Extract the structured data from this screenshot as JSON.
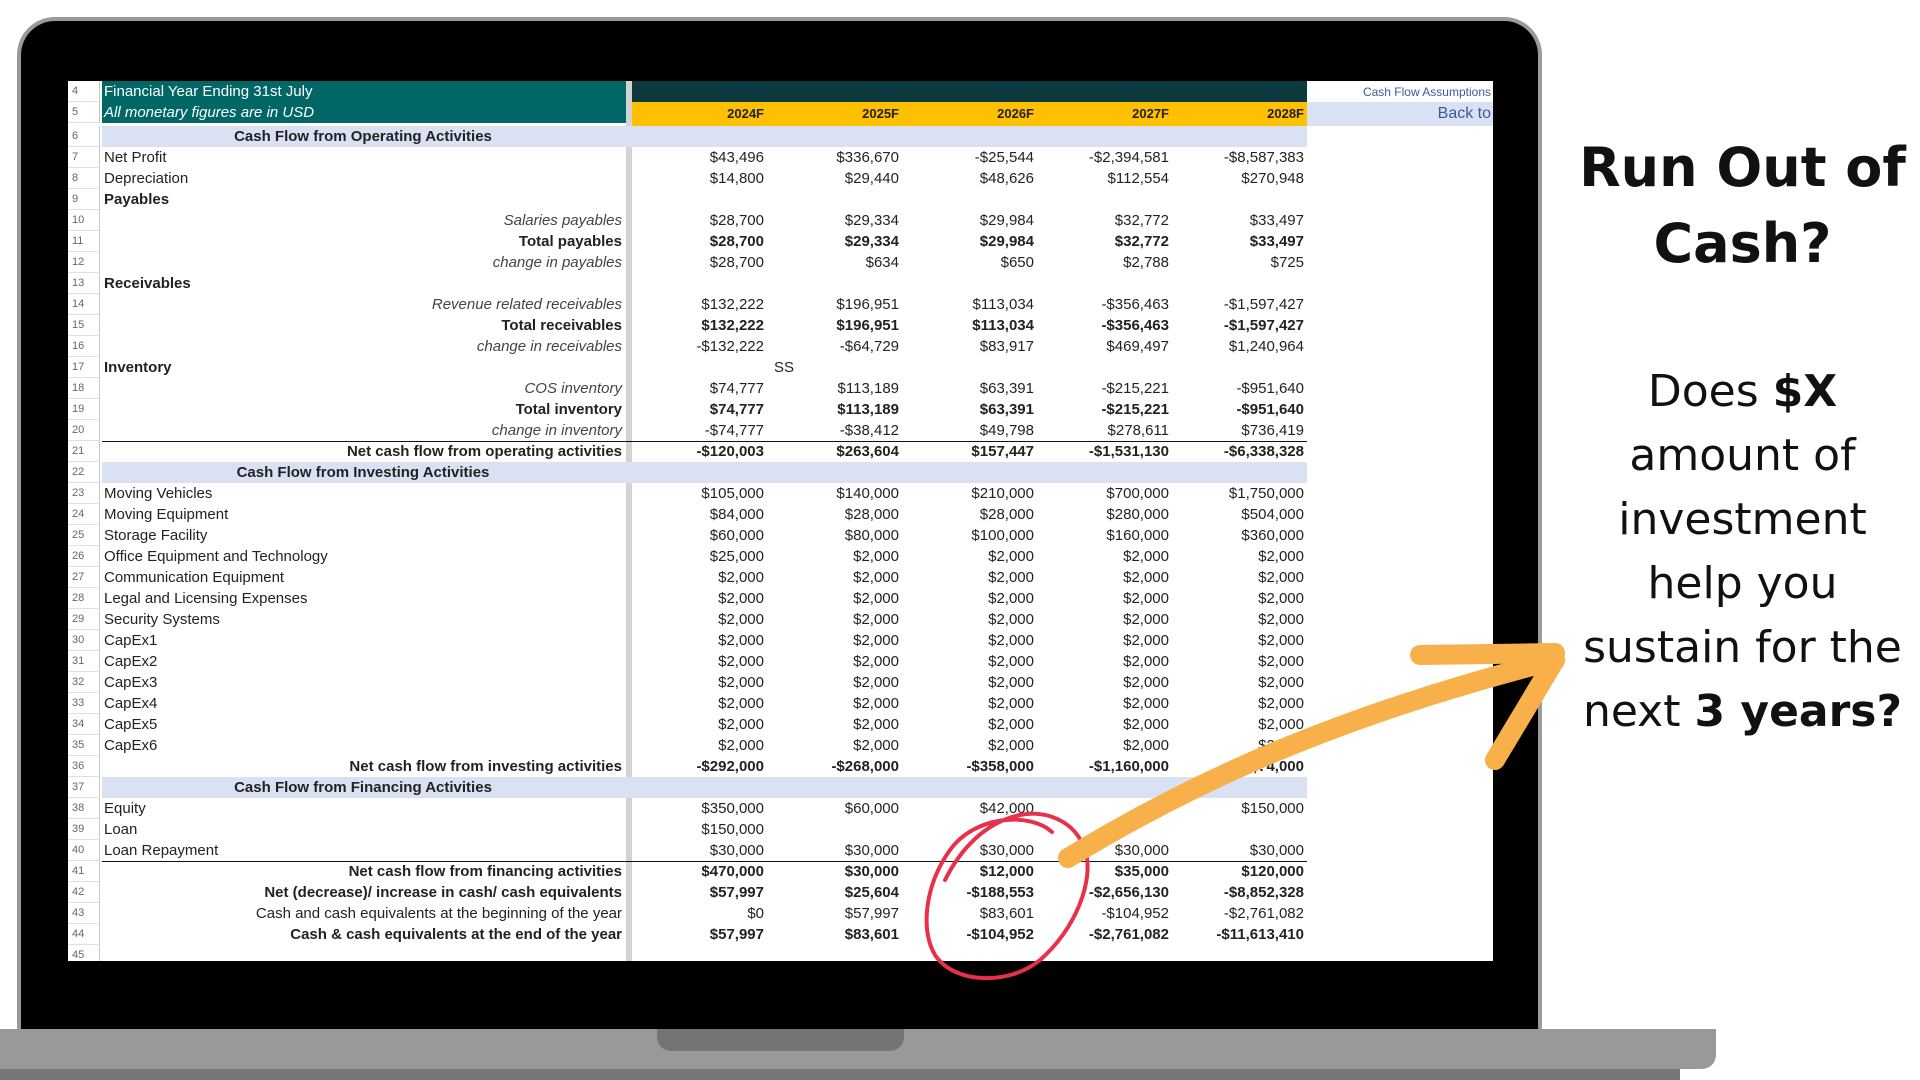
{
  "sheet": {
    "header": {
      "title": "Financial Year Ending 31st July",
      "subtitle": "All monetary figures are in USD",
      "years": [
        "2024F",
        "2025F",
        "2026F",
        "2027F",
        "2028F"
      ],
      "nav_link_assumptions": "Cash Flow Assumptions",
      "nav_link_back": "Back to"
    },
    "stray_note": "SS",
    "rows": [
      {
        "num": "6",
        "label": "Cash Flow from Operating Activities",
        "style": "section",
        "values": []
      },
      {
        "num": "7",
        "label": "Net Profit",
        "style": "plain",
        "values": [
          "$43,496",
          "$336,670",
          "-$25,544",
          "-$2,394,581",
          "-$8,587,383"
        ]
      },
      {
        "num": "8",
        "label": "Depreciation",
        "style": "plain",
        "values": [
          "$14,800",
          "$29,440",
          "$48,626",
          "$112,554",
          "$270,948"
        ]
      },
      {
        "num": "9",
        "label": "Payables",
        "style": "group",
        "values": []
      },
      {
        "num": "10",
        "label": "Salaries payables",
        "style": "italic",
        "values": [
          "$28,700",
          "$29,334",
          "$29,984",
          "$32,772",
          "$33,497"
        ]
      },
      {
        "num": "11",
        "label": "Total payables",
        "style": "subtotal",
        "values": [
          "$28,700",
          "$29,334",
          "$29,984",
          "$32,772",
          "$33,497"
        ]
      },
      {
        "num": "12",
        "label": "change in payables",
        "style": "italic",
        "values": [
          "$28,700",
          "$634",
          "$650",
          "$2,788",
          "$725"
        ]
      },
      {
        "num": "13",
        "label": "Receivables",
        "style": "group",
        "values": []
      },
      {
        "num": "14",
        "label": "Revenue related receivables",
        "style": "italic",
        "values": [
          "$132,222",
          "$196,951",
          "$113,034",
          "-$356,463",
          "-$1,597,427"
        ]
      },
      {
        "num": "15",
        "label": "Total receivables",
        "style": "total",
        "values": [
          "$132,222",
          "$196,951",
          "$113,034",
          "-$356,463",
          "-$1,597,427"
        ]
      },
      {
        "num": "16",
        "label": "change in receivables",
        "style": "italic",
        "values": [
          "-$132,222",
          "-$64,729",
          "$83,917",
          "$469,497",
          "$1,240,964"
        ]
      },
      {
        "num": "17",
        "label": "Inventory",
        "style": "group",
        "values": []
      },
      {
        "num": "18",
        "label": "COS inventory",
        "style": "italic",
        "values": [
          "$74,777",
          "$113,189",
          "$63,391",
          "-$215,221",
          "-$951,640"
        ]
      },
      {
        "num": "19",
        "label": "Total inventory",
        "style": "total",
        "values": [
          "$74,777",
          "$113,189",
          "$63,391",
          "-$215,221",
          "-$951,640"
        ]
      },
      {
        "num": "20",
        "label": "change in inventory",
        "style": "italic",
        "values": [
          "-$74,777",
          "-$38,412",
          "$49,798",
          "$278,611",
          "$736,419"
        ]
      },
      {
        "num": "21",
        "label": "Net cash flow from operating activities",
        "style": "grandtotal",
        "values": [
          "-$120,003",
          "$263,604",
          "$157,447",
          "-$1,531,130",
          "-$6,338,328"
        ]
      },
      {
        "num": "22",
        "label": "Cash Flow from Investing Activities",
        "style": "section",
        "values": []
      },
      {
        "num": "23",
        "label": "Moving Vehicles",
        "style": "plain",
        "values": [
          "$105,000",
          "$140,000",
          "$210,000",
          "$700,000",
          "$1,750,000"
        ]
      },
      {
        "num": "24",
        "label": "Moving Equipment",
        "style": "plain",
        "values": [
          "$84,000",
          "$28,000",
          "$28,000",
          "$280,000",
          "$504,000"
        ]
      },
      {
        "num": "25",
        "label": "Storage Facility",
        "style": "plain",
        "values": [
          "$60,000",
          "$80,000",
          "$100,000",
          "$160,000",
          "$360,000"
        ]
      },
      {
        "num": "26",
        "label": "Office Equipment and Technology",
        "style": "plain",
        "values": [
          "$25,000",
          "$2,000",
          "$2,000",
          "$2,000",
          "$2,000"
        ]
      },
      {
        "num": "27",
        "label": "Communication Equipment",
        "style": "plain",
        "values": [
          "$2,000",
          "$2,000",
          "$2,000",
          "$2,000",
          "$2,000"
        ]
      },
      {
        "num": "28",
        "label": "Legal and Licensing Expenses",
        "style": "plain",
        "values": [
          "$2,000",
          "$2,000",
          "$2,000",
          "$2,000",
          "$2,000"
        ]
      },
      {
        "num": "29",
        "label": "Security Systems",
        "style": "plain",
        "values": [
          "$2,000",
          "$2,000",
          "$2,000",
          "$2,000",
          "$2,000"
        ]
      },
      {
        "num": "30",
        "label": "CapEx1",
        "style": "plain",
        "values": [
          "$2,000",
          "$2,000",
          "$2,000",
          "$2,000",
          "$2,000"
        ]
      },
      {
        "num": "31",
        "label": "CapEx2",
        "style": "plain",
        "values": [
          "$2,000",
          "$2,000",
          "$2,000",
          "$2,000",
          "$2,000"
        ]
      },
      {
        "num": "32",
        "label": "CapEx3",
        "style": "plain",
        "values": [
          "$2,000",
          "$2,000",
          "$2,000",
          "$2,000",
          "$2,000"
        ]
      },
      {
        "num": "33",
        "label": "CapEx4",
        "style": "plain",
        "values": [
          "$2,000",
          "$2,000",
          "$2,000",
          "$2,000",
          "$2,000"
        ]
      },
      {
        "num": "34",
        "label": "CapEx5",
        "style": "plain",
        "values": [
          "$2,000",
          "$2,000",
          "$2,000",
          "$2,000",
          "$2,000"
        ]
      },
      {
        "num": "35",
        "label": "CapEx6",
        "style": "plain",
        "values": [
          "$2,000",
          "$2,000",
          "$2,000",
          "$2,000",
          "$2,000"
        ]
      },
      {
        "num": "36",
        "label": "Net cash flow from investing activities",
        "style": "total",
        "values": [
          "-$292,000",
          "-$268,000",
          "-$358,000",
          "-$1,160,000",
          "-$?,?4,000"
        ]
      },
      {
        "num": "37",
        "label": "Cash Flow from Financing Activities",
        "style": "section",
        "values": []
      },
      {
        "num": "38",
        "label": "Equity",
        "style": "plain",
        "values": [
          "$350,000",
          "$60,000",
          "$42,000",
          "$?",
          "$150,000"
        ]
      },
      {
        "num": "39",
        "label": "Loan",
        "style": "plain",
        "values": [
          "$150,000",
          "",
          "",
          "",
          ""
        ]
      },
      {
        "num": "40",
        "label": "Loan Repayment",
        "style": "plain",
        "values": [
          "$30,000",
          "$30,000",
          "$30,000",
          "$30,000",
          "$30,000"
        ]
      },
      {
        "num": "41",
        "label": "Net cash flow from financing activities",
        "style": "grandtotal",
        "values": [
          "$470,000",
          "$30,000",
          "$12,000",
          "$35,000",
          "$120,000"
        ]
      },
      {
        "num": "42",
        "label": "Net (decrease)/ increase in cash/ cash equivalents",
        "style": "total",
        "values": [
          "$57,997",
          "$25,604",
          "-$188,553",
          "-$2,656,130",
          "-$8,852,328"
        ]
      },
      {
        "num": "43",
        "label": "Cash and cash equivalents at the beginning of the year",
        "style": "rightplain",
        "values": [
          "$0",
          "$57,997",
          "$83,601",
          "-$104,952",
          "-$2,761,082"
        ]
      },
      {
        "num": "44",
        "label": "Cash & cash equivalents at the end of the year",
        "style": "total",
        "values": [
          "$57,997",
          "$83,601",
          "-$104,952",
          "-$2,761,082",
          "-$11,613,410"
        ]
      },
      {
        "num": "45",
        "label": "",
        "style": "plain",
        "values": []
      }
    ]
  },
  "callout": {
    "title_line1": "Run Out of",
    "title_line2": "Cash?",
    "body_lines": [
      {
        "pre": "Does ",
        "bold": "$X",
        "post": ""
      },
      {
        "pre": "amount of",
        "bold": "",
        "post": ""
      },
      {
        "pre": "investment",
        "bold": "",
        "post": ""
      },
      {
        "pre": "help you",
        "bold": "",
        "post": ""
      },
      {
        "pre": "sustain for the",
        "bold": "",
        "post": ""
      },
      {
        "pre": "next ",
        "bold": "3 years?",
        "post": ""
      }
    ]
  },
  "annotations": {
    "circle_color": "#e8304a",
    "arrow_color": "#f8b04a",
    "highlight_year": "2026F",
    "highlight_value": "-$104,952"
  },
  "colors": {
    "header_teal": "#006666",
    "header_dark": "#0d3a3f",
    "year_band": "#ffc000",
    "section_band": "#d9e1f2",
    "link_blue": "#3a5a9a"
  }
}
